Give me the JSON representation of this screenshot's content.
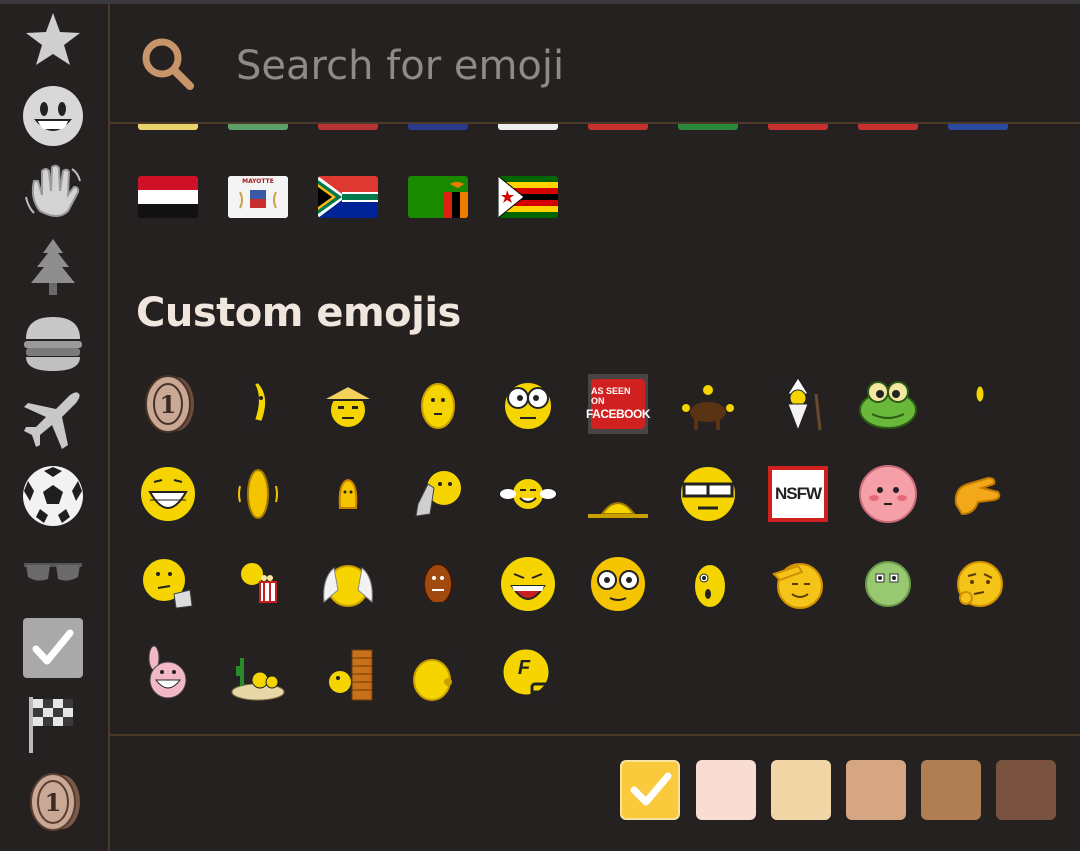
{
  "search": {
    "placeholder": "Search for emoji",
    "value": ""
  },
  "sidebar": {
    "items": [
      {
        "name": "recent",
        "icon": "star-icon"
      },
      {
        "name": "smileys",
        "icon": "smiley-icon"
      },
      {
        "name": "people",
        "icon": "waving-hand-icon"
      },
      {
        "name": "nature",
        "icon": "evergreen-tree-icon"
      },
      {
        "name": "food",
        "icon": "hamburger-icon"
      },
      {
        "name": "travel",
        "icon": "airplane-icon"
      },
      {
        "name": "activities",
        "icon": "soccer-ball-icon"
      },
      {
        "name": "objects",
        "icon": "sunglasses-icon"
      },
      {
        "name": "symbols",
        "icon": "check-mark-icon"
      },
      {
        "name": "flags",
        "icon": "chequered-flag-icon"
      },
      {
        "name": "custom",
        "icon": "custom-coin-icon"
      }
    ]
  },
  "flags": {
    "items": [
      "flag-yemen",
      "flag-mayotte",
      "flag-south-africa",
      "flag-zambia",
      "flag-zimbabwe"
    ],
    "mayotte_label": "MAYOTTE"
  },
  "custom": {
    "title": "Custom emojis",
    "rows": [
      [
        "coin",
        "dancing-banana",
        "straw-hat-smiley",
        "yellow-egg-face",
        "goggle-eyes-face",
        "as-seen-on-facebook",
        "bison-with-smileys",
        "wizard-smiley",
        "frog-face",
        "tiny-yellow-figure"
      ],
      [
        "big-grin",
        "spinning-coin",
        "tiny-blob",
        "thinking-finger",
        "laughing-wings",
        "sinking-blob",
        "shades-smiley",
        "nsfw-sign",
        "blushing-pink",
        "pinching-hand"
      ],
      [
        "thinking-thumb",
        "popcorn-eating",
        "hands-over-ears",
        "brown-potato",
        "laughing-open",
        "wide-glasses",
        "surprised-face",
        "saluting-face",
        "green-alien",
        "raised-eyebrow"
      ],
      [
        "pink-rabbit",
        "desert-smiley",
        "wall-peek",
        "whistling-face",
        "football-helmet"
      ]
    ],
    "facebook_label_top": "AS SEEN ON",
    "facebook_label_bottom": "FACEBOOK",
    "nsfw_label": "NSFW",
    "coin_label": "1",
    "helmet_label": "F"
  },
  "skin_tones": {
    "selected": 0,
    "colors": [
      "#fbc93c",
      "#f9ddd2",
      "#f2d6a6",
      "#d6a683",
      "#b07e55",
      "#7a5240"
    ]
  },
  "colors": {
    "background": "#262121",
    "divider": "#4a3a2a",
    "search_icon": "#c8956a",
    "title": "#f1e6de"
  }
}
